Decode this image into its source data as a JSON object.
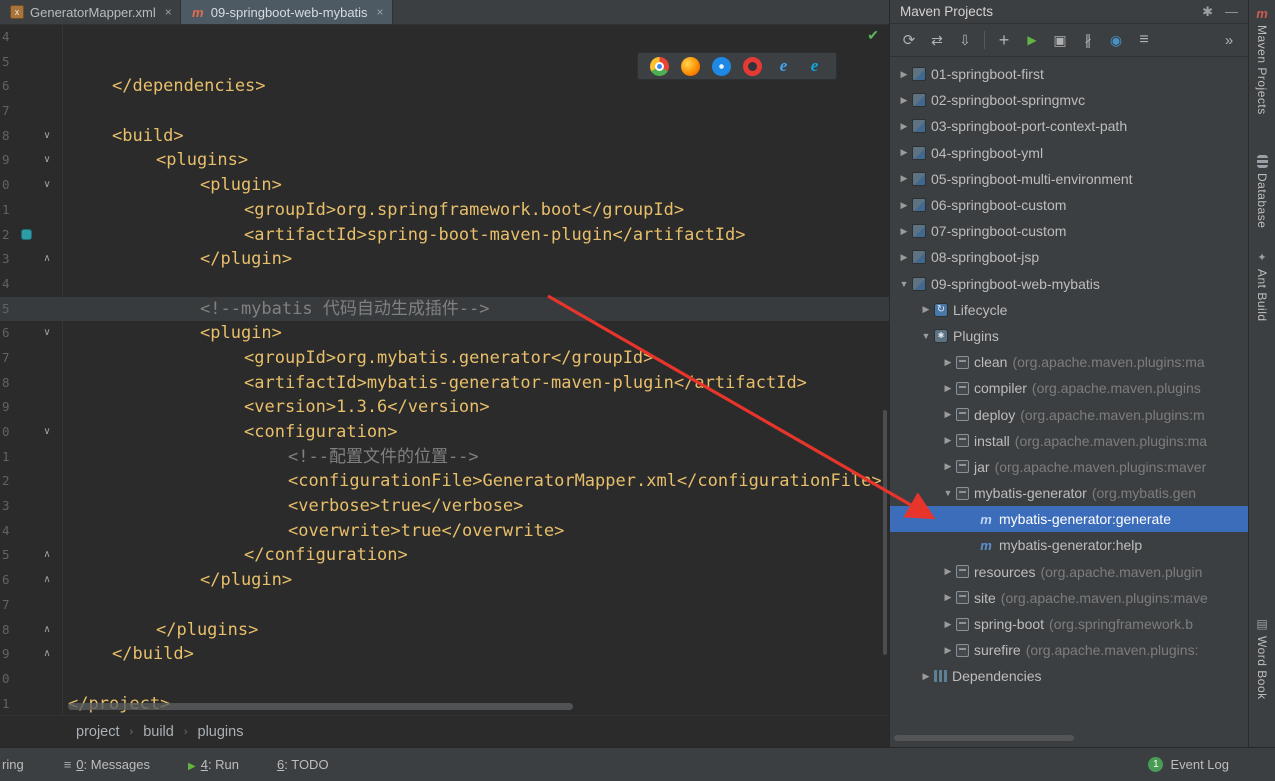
{
  "colors": {
    "selection_blue": "#3c6dbb",
    "arrow_red": "#e8352c",
    "run_green": "#62b543",
    "code_amber": "#e8bf6a",
    "comment_gray": "#808080",
    "event_badge_green": "#499c54"
  },
  "tabs": [
    {
      "label": "GeneratorMapper.xml",
      "icon": "xml-file-icon",
      "active": false
    },
    {
      "label": "09-springboot-web-mybatis",
      "icon": "maven-file-icon",
      "active": true
    }
  ],
  "editor": {
    "lines": [
      {
        "num": "4",
        "indent": 0,
        "text": "",
        "kind": "blank",
        "fold": "",
        "gutter_icon": false,
        "current": false
      },
      {
        "num": "5",
        "indent": 0,
        "text": "",
        "kind": "blank",
        "fold": "",
        "gutter_icon": false,
        "current": false
      },
      {
        "num": "6",
        "indent": 1,
        "text": "</dependencies>",
        "kind": "code",
        "fold": "",
        "gutter_icon": false,
        "current": false
      },
      {
        "num": "7",
        "indent": 0,
        "text": "",
        "kind": "blank",
        "fold": "",
        "gutter_icon": false,
        "current": false
      },
      {
        "num": "8",
        "indent": 1,
        "text": "<build>",
        "kind": "code",
        "fold": "open",
        "gutter_icon": false,
        "current": false
      },
      {
        "num": "9",
        "indent": 2,
        "text": "<plugins>",
        "kind": "code",
        "fold": "open",
        "gutter_icon": false,
        "current": false
      },
      {
        "num": "0",
        "indent": 3,
        "text": "<plugin>",
        "kind": "code",
        "fold": "open",
        "gutter_icon": false,
        "current": false
      },
      {
        "num": "1",
        "indent": 4,
        "text": "<groupId>org.springframework.boot</groupId>",
        "kind": "code",
        "fold": "",
        "gutter_icon": false,
        "current": false
      },
      {
        "num": "2",
        "indent": 4,
        "text": "<artifactId>spring-boot-maven-plugin</artifactId>",
        "kind": "code",
        "fold": "",
        "gutter_icon": true,
        "current": false
      },
      {
        "num": "3",
        "indent": 3,
        "text": "</plugin>",
        "kind": "code",
        "fold": "close",
        "gutter_icon": false,
        "current": false
      },
      {
        "num": "4",
        "indent": 0,
        "text": "",
        "kind": "blank",
        "fold": "",
        "gutter_icon": false,
        "current": false
      },
      {
        "num": "5",
        "indent": 3,
        "text": "<!--mybatis 代码自动生成插件-->",
        "kind": "comment",
        "fold": "",
        "gutter_icon": false,
        "current": true
      },
      {
        "num": "6",
        "indent": 3,
        "text": "<plugin>",
        "kind": "code",
        "fold": "open",
        "gutter_icon": false,
        "current": false
      },
      {
        "num": "7",
        "indent": 4,
        "text": "<groupId>org.mybatis.generator</groupId>",
        "kind": "code",
        "fold": "",
        "gutter_icon": false,
        "current": false
      },
      {
        "num": "8",
        "indent": 4,
        "text": "<artifactId>mybatis-generator-maven-plugin</artifactId>",
        "kind": "code",
        "fold": "",
        "gutter_icon": false,
        "current": false
      },
      {
        "num": "9",
        "indent": 4,
        "text": "<version>1.3.6</version>",
        "kind": "code",
        "fold": "",
        "gutter_icon": false,
        "current": false
      },
      {
        "num": "0",
        "indent": 4,
        "text": "<configuration>",
        "kind": "code",
        "fold": "open",
        "gutter_icon": false,
        "current": false
      },
      {
        "num": "1",
        "indent": 5,
        "text": "<!--配置文件的位置-->",
        "kind": "comment",
        "fold": "",
        "gutter_icon": false,
        "current": false
      },
      {
        "num": "2",
        "indent": 5,
        "text": "<configurationFile>GeneratorMapper.xml</configurationFile>",
        "kind": "code",
        "fold": "",
        "gutter_icon": false,
        "current": false
      },
      {
        "num": "3",
        "indent": 5,
        "text": "<verbose>true</verbose>",
        "kind": "code",
        "fold": "",
        "gutter_icon": false,
        "current": false
      },
      {
        "num": "4",
        "indent": 5,
        "text": "<overwrite>true</overwrite>",
        "kind": "code",
        "fold": "",
        "gutter_icon": false,
        "current": false
      },
      {
        "num": "5",
        "indent": 4,
        "text": "</configuration>",
        "kind": "code",
        "fold": "close",
        "gutter_icon": false,
        "current": false
      },
      {
        "num": "6",
        "indent": 3,
        "text": "</plugin>",
        "kind": "code",
        "fold": "close",
        "gutter_icon": false,
        "current": false
      },
      {
        "num": "7",
        "indent": 0,
        "text": "",
        "kind": "blank",
        "fold": "",
        "gutter_icon": false,
        "current": false
      },
      {
        "num": "8",
        "indent": 2,
        "text": "</plugins>",
        "kind": "code",
        "fold": "close",
        "gutter_icon": false,
        "current": false
      },
      {
        "num": "9",
        "indent": 1,
        "text": "</build>",
        "kind": "code",
        "fold": "close",
        "gutter_icon": false,
        "current": false
      },
      {
        "num": "0",
        "indent": 0,
        "text": "",
        "kind": "blank",
        "fold": "",
        "gutter_icon": false,
        "current": false
      },
      {
        "num": "1",
        "indent": 0,
        "text": "</project>",
        "kind": "code",
        "fold": "",
        "gutter_icon": false,
        "current": false
      }
    ]
  },
  "breadcrumbs": [
    "project",
    "build",
    "plugins"
  ],
  "browser_bar": [
    "chrome-icon",
    "firefox-icon",
    "safari-icon",
    "opera-icon",
    "ie-icon",
    "edge-icon"
  ],
  "maven_panel": {
    "title": "Maven Projects",
    "toolbar": [
      "refresh-icon",
      "generate-sources-icon",
      "download-sources-icon",
      "separator",
      "add-maven-project-icon",
      "run-build-icon",
      "execute-goal-icon",
      "skip-tests-icon",
      "toggle-offline-icon",
      "filter-icon",
      "more-icon"
    ],
    "tree": [
      {
        "level": 0,
        "arrow": "collapsed",
        "icon": "maven-module-icon",
        "name": "01-springboot-first",
        "qualifier": "",
        "selected": false
      },
      {
        "level": 0,
        "arrow": "collapsed",
        "icon": "maven-module-icon",
        "name": "02-springboot-springmvc",
        "qualifier": "",
        "selected": false
      },
      {
        "level": 0,
        "arrow": "collapsed",
        "icon": "maven-module-icon",
        "name": "03-springboot-port-context-path",
        "qualifier": "",
        "selected": false
      },
      {
        "level": 0,
        "arrow": "collapsed",
        "icon": "maven-module-icon",
        "name": "04-springboot-yml",
        "qualifier": "",
        "selected": false
      },
      {
        "level": 0,
        "arrow": "collapsed",
        "icon": "maven-module-icon",
        "name": "05-springboot-multi-environment",
        "qualifier": "",
        "selected": false
      },
      {
        "level": 0,
        "arrow": "collapsed",
        "icon": "maven-module-icon",
        "name": "06-springboot-custom",
        "qualifier": "",
        "selected": false
      },
      {
        "level": 0,
        "arrow": "collapsed",
        "icon": "maven-module-icon",
        "name": "07-springboot-custom",
        "qualifier": "",
        "selected": false
      },
      {
        "level": 0,
        "arrow": "collapsed",
        "icon": "maven-module-icon",
        "name": "08-springboot-jsp",
        "qualifier": "",
        "selected": false
      },
      {
        "level": 0,
        "arrow": "expanded",
        "icon": "maven-module-icon",
        "name": "09-springboot-web-mybatis",
        "qualifier": "",
        "selected": false
      },
      {
        "level": 1,
        "arrow": "collapsed",
        "icon": "lifecycle-icon",
        "name": "Lifecycle",
        "qualifier": "",
        "selected": false
      },
      {
        "level": 1,
        "arrow": "expanded",
        "icon": "plugins-icon",
        "name": "Plugins",
        "qualifier": "",
        "selected": false
      },
      {
        "level": 2,
        "arrow": "collapsed",
        "icon": "plugin-icon",
        "name": "clean",
        "qualifier": "(org.apache.maven.plugins:ma",
        "selected": false
      },
      {
        "level": 2,
        "arrow": "collapsed",
        "icon": "plugin-icon",
        "name": "compiler",
        "qualifier": "(org.apache.maven.plugins",
        "selected": false
      },
      {
        "level": 2,
        "arrow": "collapsed",
        "icon": "plugin-icon",
        "name": "deploy",
        "qualifier": "(org.apache.maven.plugins:m",
        "selected": false
      },
      {
        "level": 2,
        "arrow": "collapsed",
        "icon": "plugin-icon",
        "name": "install",
        "qualifier": "(org.apache.maven.plugins:ma",
        "selected": false
      },
      {
        "level": 2,
        "arrow": "collapsed",
        "icon": "plugin-icon",
        "name": "jar",
        "qualifier": "(org.apache.maven.plugins:maver",
        "selected": false
      },
      {
        "level": 2,
        "arrow": "expanded",
        "icon": "plugin-icon",
        "name": "mybatis-generator",
        "qualifier": "(org.mybatis.gen",
        "selected": false
      },
      {
        "level": 3,
        "arrow": "none",
        "icon": "goal-icon",
        "name": "mybatis-generator:generate",
        "qualifier": "",
        "selected": true
      },
      {
        "level": 3,
        "arrow": "none",
        "icon": "goal-icon",
        "name": "mybatis-generator:help",
        "qualifier": "",
        "selected": false
      },
      {
        "level": 2,
        "arrow": "collapsed",
        "icon": "plugin-icon",
        "name": "resources",
        "qualifier": "(org.apache.maven.plugin",
        "selected": false
      },
      {
        "level": 2,
        "arrow": "collapsed",
        "icon": "plugin-icon",
        "name": "site",
        "qualifier": "(org.apache.maven.plugins:mave",
        "selected": false
      },
      {
        "level": 2,
        "arrow": "collapsed",
        "icon": "plugin-icon",
        "name": "spring-boot",
        "qualifier": "(org.springframework.b",
        "selected": false
      },
      {
        "level": 2,
        "arrow": "collapsed",
        "icon": "plugin-icon",
        "name": "surefire",
        "qualifier": "(org.apache.maven.plugins:",
        "selected": false
      },
      {
        "level": 1,
        "arrow": "collapsed",
        "icon": "dependencies-icon",
        "name": "Dependencies",
        "qualifier": "",
        "selected": false
      }
    ]
  },
  "tool_stripe": [
    {
      "label": "Maven Projects",
      "icon": "maven-icon"
    },
    {
      "label": "Database",
      "icon": "database-icon"
    },
    {
      "label": "Ant Build",
      "icon": "ant-icon"
    },
    {
      "label": "Word Book",
      "icon": "book-icon"
    }
  ],
  "statusbar": {
    "left_partial": "ring",
    "messages": {
      "mnemonic": "0",
      "rest": ": Messages"
    },
    "run": {
      "mnemonic": "4",
      "rest": ": Run"
    },
    "todo": {
      "mnemonic": "6",
      "rest": ": TODO"
    },
    "event_log": {
      "badge": "1",
      "label": "Event Log"
    }
  }
}
